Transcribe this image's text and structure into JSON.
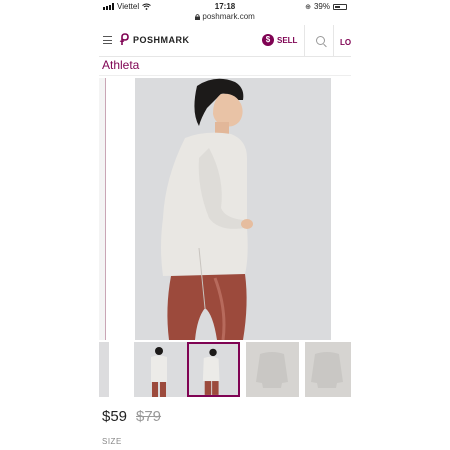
{
  "status_bar": {
    "carrier": "Viettel",
    "time": "17:18",
    "url": "poshmark.com",
    "battery": "39%"
  },
  "header": {
    "logo_text": "POSHMARK",
    "sell_label": "SELL",
    "sell_glyph": "$",
    "login_label": "LO"
  },
  "listing": {
    "brand": "Athleta",
    "price": "$59",
    "original_price": "$79",
    "size_label": "SIZE"
  },
  "colors": {
    "brand_accent": "#7f0353",
    "sweater": "#e8e6e2",
    "leggings": "#9c4a3c"
  },
  "icons": [
    "hamburger-menu-icon",
    "poshmark-logo-icon",
    "sell-dollar-icon",
    "search-icon",
    "wifi-icon",
    "lock-icon",
    "battery-icon"
  ]
}
